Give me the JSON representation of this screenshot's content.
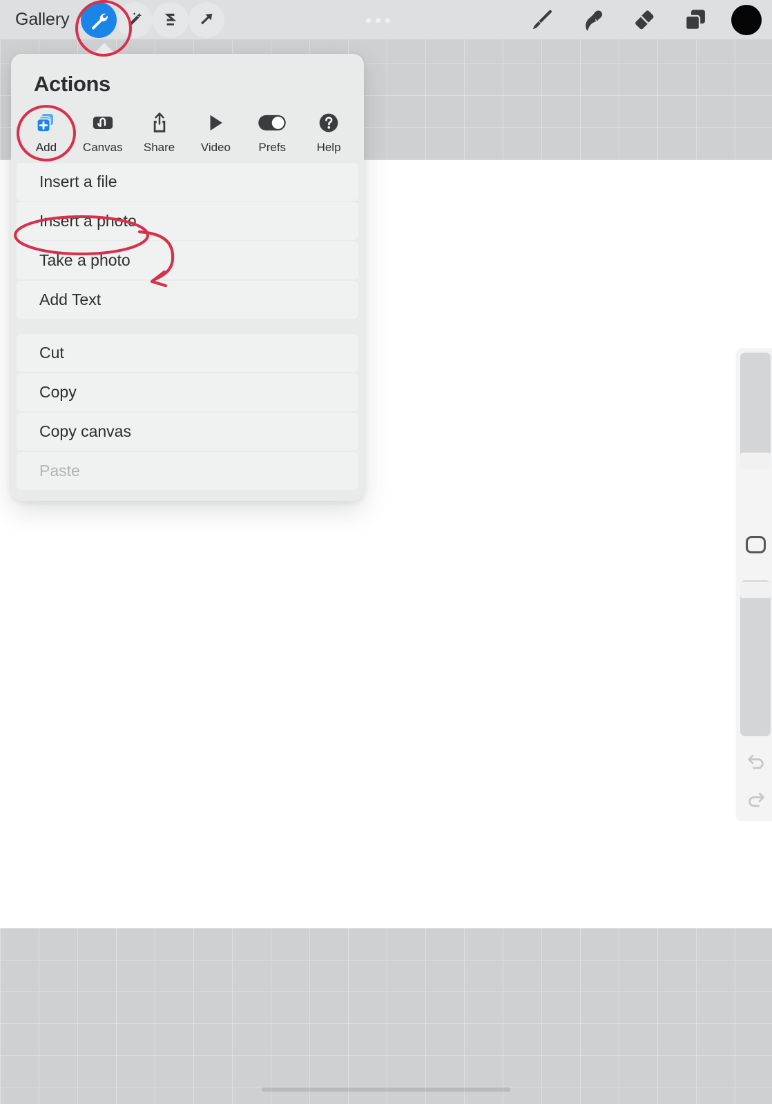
{
  "app": {
    "name": "Procreate",
    "accent_blue": "#1a84e8",
    "annotation_red": "#d6314c",
    "toolbar_bg": "#dedfe0",
    "panel_bg": "#e9eaea",
    "canvas_bg": "#ffffff",
    "backdrop_grey": "#cfd0d1"
  },
  "toolbar": {
    "gallery_label": "Gallery",
    "left_tools": [
      {
        "name": "actions-wrench",
        "icon": "wrench-icon",
        "label": "Actions",
        "selected": true
      },
      {
        "name": "adjustments",
        "icon": "magic-wand-icon",
        "label": "Adjustments",
        "selected": false
      },
      {
        "name": "selection",
        "icon": "selection-s-icon",
        "label": "Selection",
        "selected": false
      },
      {
        "name": "transform",
        "icon": "arrow-transform-icon",
        "label": "Transform",
        "selected": false
      }
    ],
    "right_tools": [
      {
        "name": "paint",
        "icon": "brush-icon",
        "label": "Paint"
      },
      {
        "name": "smudge",
        "icon": "smudge-finger-icon",
        "label": "Smudge"
      },
      {
        "name": "erase",
        "icon": "eraser-icon",
        "label": "Erase"
      },
      {
        "name": "layers",
        "icon": "layers-icon",
        "label": "Layers"
      },
      {
        "name": "color",
        "icon": "color-swatch-icon",
        "label": "Color",
        "swatch": "#050505"
      }
    ]
  },
  "panel": {
    "title": "Actions",
    "tabs": [
      {
        "label": "Add",
        "icon": "add-layer-plus-icon",
        "active": true
      },
      {
        "label": "Canvas",
        "icon": "canvas-squiggle-icon",
        "active": false
      },
      {
        "label": "Share",
        "icon": "share-upload-icon",
        "active": false
      },
      {
        "label": "Video",
        "icon": "play-triangle-icon",
        "active": false
      },
      {
        "label": "Prefs",
        "icon": "toggle-switch-icon",
        "active": false
      },
      {
        "label": "Help",
        "icon": "question-mark-icon",
        "active": false
      }
    ],
    "group_one": [
      {
        "label": "Insert a file",
        "disabled": false,
        "highlighted": false
      },
      {
        "label": "Insert a photo",
        "disabled": false,
        "highlighted": true
      },
      {
        "label": "Take a photo",
        "disabled": false,
        "highlighted": false
      },
      {
        "label": "Add Text",
        "disabled": false,
        "highlighted": false
      }
    ],
    "group_two": [
      {
        "label": "Cut",
        "disabled": false
      },
      {
        "label": "Copy",
        "disabled": false
      },
      {
        "label": "Copy canvas",
        "disabled": false
      },
      {
        "label": "Paste",
        "disabled": true
      }
    ]
  },
  "sidebar": {
    "brush_size_slider": {
      "name": "brush-size-slider",
      "value_pct": 66
    },
    "opacity_slider": {
      "name": "opacity-slider",
      "value_pct": 96
    },
    "modify_button": {
      "name": "modify-square-button"
    },
    "undo_button": {
      "name": "undo-button",
      "icon": "undo-arrow-icon"
    },
    "redo_button": {
      "name": "redo-button",
      "icon": "redo-arrow-icon"
    }
  },
  "annotations": [
    {
      "name": "wrench-highlight-circle",
      "shape": "ellipse",
      "target": "actions-wrench"
    },
    {
      "name": "add-tab-highlight-circle",
      "shape": "ellipse",
      "target": "tab-add"
    },
    {
      "name": "insert-photo-highlight-ellipse",
      "shape": "ellipse",
      "target": "menu-item-insert-a-photo"
    },
    {
      "name": "pointer-arrow",
      "shape": "curved-arrow",
      "target": "menu-item-insert-a-photo"
    }
  ]
}
